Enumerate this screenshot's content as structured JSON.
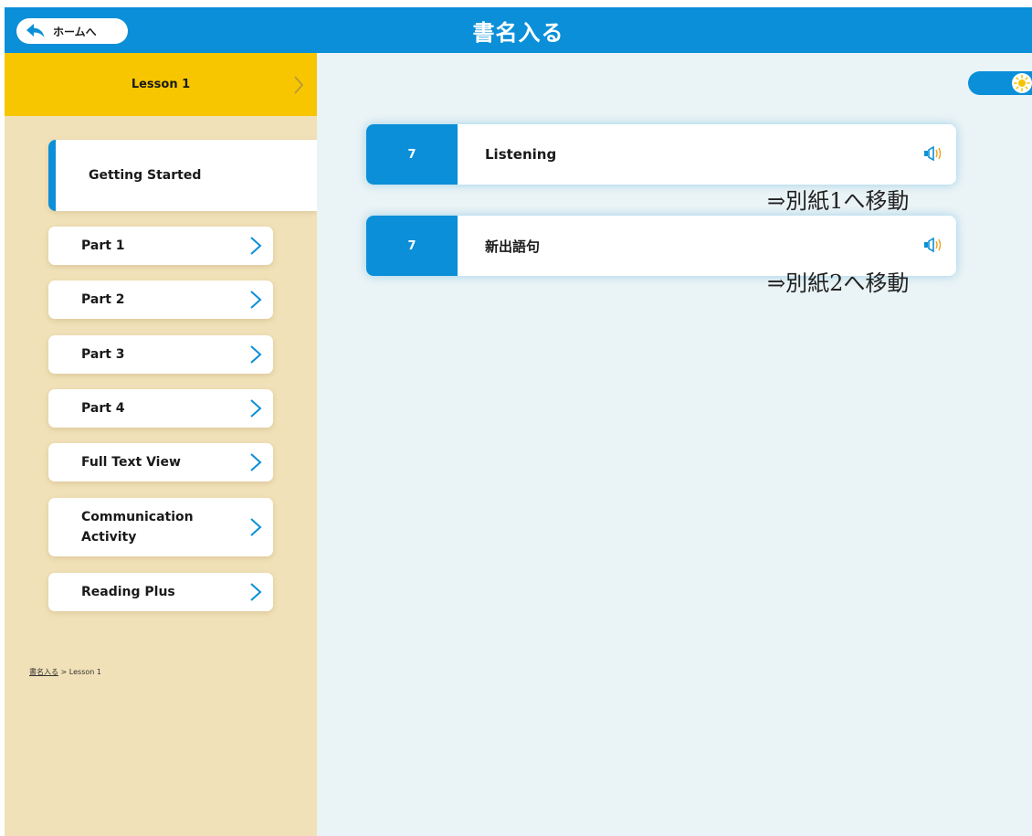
{
  "header": {
    "home_label": "ホームへ",
    "title": "書名入る"
  },
  "sidebar": {
    "lesson_label": "Lesson 1",
    "active_item": "Getting Started",
    "items": [
      {
        "label": "Part 1"
      },
      {
        "label": "Part 2"
      },
      {
        "label": "Part 3"
      },
      {
        "label": "Part 4"
      },
      {
        "label": "Full Text View"
      },
      {
        "label": "Communication Activity"
      },
      {
        "label": "Reading Plus"
      }
    ],
    "breadcrumb": {
      "book": "書名入る",
      "separator": " > ",
      "current": "Lesson 1"
    }
  },
  "main": {
    "cards": [
      {
        "number": "7",
        "title": "Listening",
        "note": "⇒別紙1へ移動"
      },
      {
        "number": "7",
        "title": "新出語句",
        "note": "⇒別紙2へ移動"
      }
    ]
  },
  "colors": {
    "header_blue": "#0b8fd8",
    "lesson_yellow": "#f7c600",
    "sidebar_bg": "#f1e1b8",
    "main_bg": "#eaf3f5",
    "speaker_orange": "#f0a020"
  },
  "icons": {
    "home": "back-arrow-icon",
    "lesson_chevron": "chevron-right-icon",
    "nav_chevron": "chevron-right-icon",
    "audio": "speaker-icon",
    "theme": "sun-icon"
  }
}
